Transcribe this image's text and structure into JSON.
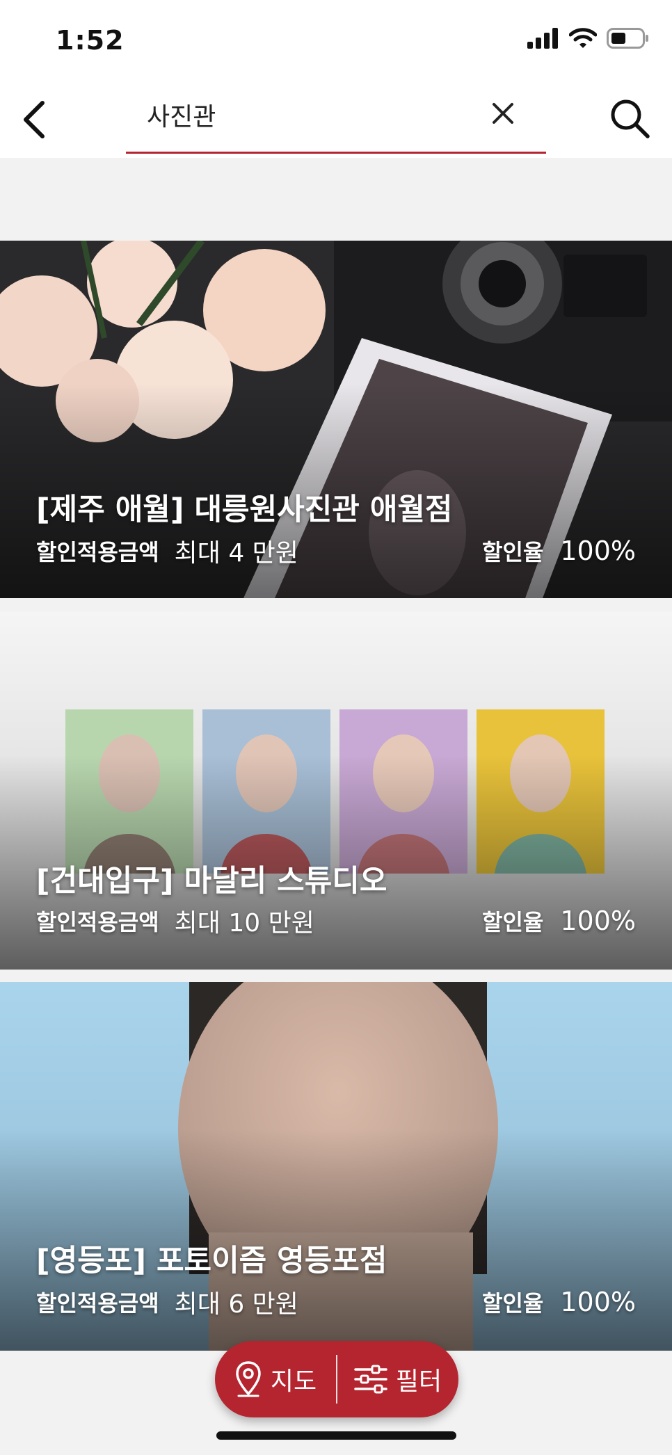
{
  "status_bar": {
    "time": "1:52"
  },
  "search": {
    "query": "사진관"
  },
  "results": [
    {
      "title": "[제주 애월] 대릉원사진관 애월점",
      "discount_amount_label": "할인적용금액",
      "discount_amount_value": "최대 4 만원",
      "discount_rate_label": "할인율",
      "discount_rate_value": "100%"
    },
    {
      "title": "[건대입구] 마달리 스튜디오",
      "discount_amount_label": "할인적용금액",
      "discount_amount_value": "최대 10 만원",
      "discount_rate_label": "할인율",
      "discount_rate_value": "100%"
    },
    {
      "title": "[영등포] 포토이즘 영등포점",
      "discount_amount_label": "할인적용금액",
      "discount_amount_value": "최대 6 만원",
      "discount_rate_label": "할인율",
      "discount_rate_value": "100%"
    }
  ],
  "bottom_bar": {
    "map_label": "지도",
    "filter_label": "필터"
  },
  "colors": {
    "accent": "#b5252f",
    "background": "#f2f2f2"
  },
  "icons": {
    "back": "chevron-left-icon",
    "clear": "close-icon",
    "search": "search-icon",
    "map": "map-pin-icon",
    "filter": "sliders-icon"
  }
}
